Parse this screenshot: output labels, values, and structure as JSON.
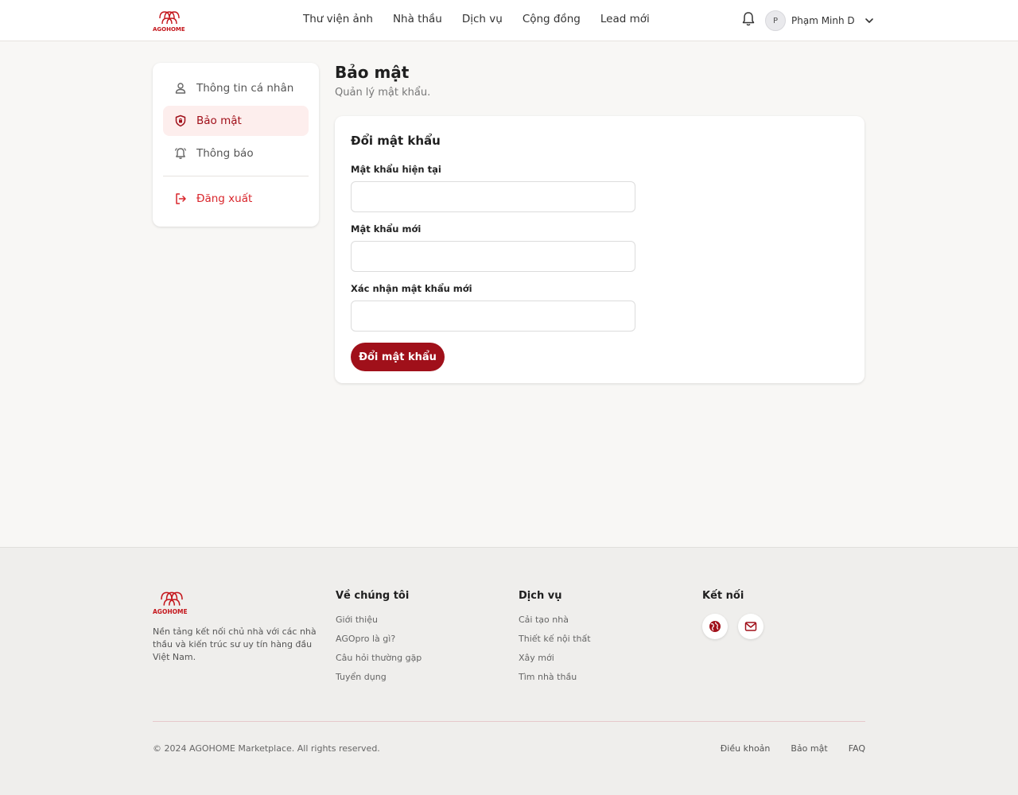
{
  "header": {
    "logo_text": "AGOHOME",
    "nav": [
      "Thư viện ảnh",
      "Nhà thầu",
      "Dịch vụ",
      "Cộng đồng",
      "Lead mới"
    ],
    "avatar_letter": "P",
    "username": "Phạm Minh D"
  },
  "sidebar": {
    "items": [
      {
        "label": "Thông tin cá nhân",
        "icon": "user-icon"
      },
      {
        "label": "Bảo mật",
        "icon": "shield-icon"
      },
      {
        "label": "Thông báo",
        "icon": "bell-icon"
      }
    ],
    "logout": {
      "label": "Đăng xuất",
      "icon": "logout-icon"
    }
  },
  "main": {
    "title": "Bảo mật",
    "subtitle": "Quản lý mật khẩu.",
    "card_title": "Đổi mật khẩu",
    "fields": [
      {
        "label": "Mật khẩu hiện tại",
        "value": ""
      },
      {
        "label": "Mật khẩu mới",
        "value": ""
      },
      {
        "label": "Xác nhận mật khẩu mới",
        "value": ""
      }
    ],
    "submit_label": "Đổi mật khẩu"
  },
  "footer": {
    "logo_text": "AGOHOME",
    "description": "Nền tảng kết nối chủ nhà với các nhà thầu và kiến trúc sư uy tín hàng đầu Việt Nam.",
    "columns": [
      {
        "title": "Về chúng tôi",
        "links": [
          "Giới thiệu",
          "AGOpro là gì?",
          "Câu hỏi thường gặp",
          "Tuyển dụng"
        ]
      },
      {
        "title": "Dịch vụ",
        "links": [
          "Cải tạo nhà",
          "Thiết kế nội thất",
          "Xây mới",
          "Tìm nhà thầu"
        ]
      }
    ],
    "connect_title": "Kết nối",
    "social": [
      "globe-icon",
      "mail-icon"
    ],
    "copyright": "© 2024 AGOHOME Marketplace. All rights reserved.",
    "bottom_links": [
      "Điều khoản",
      "Bảo mật",
      "FAQ"
    ]
  },
  "colors": {
    "brand": "#a0101a",
    "logo_red": "#c4161c",
    "active_bg": "#fdeeed",
    "logout": "#d9262c"
  }
}
